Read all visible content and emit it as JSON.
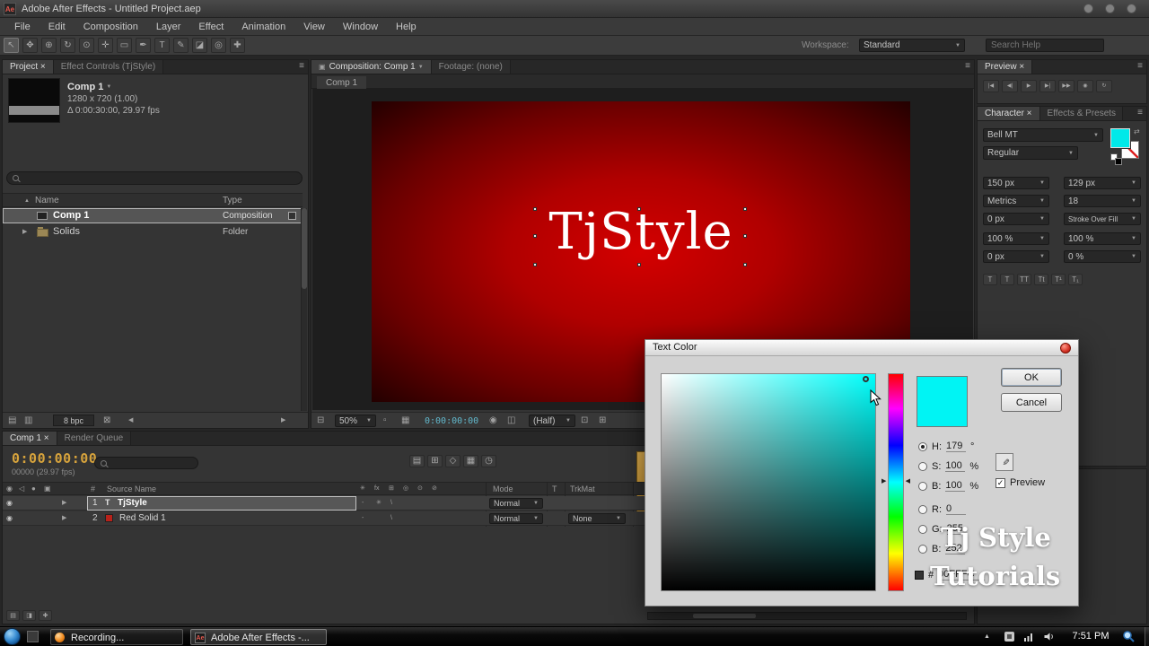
{
  "titlebar": {
    "app_icon": "Ae",
    "title": "Adobe After Effects - Untitled Project.aep"
  },
  "menubar": {
    "items": [
      "File",
      "Edit",
      "Composition",
      "Layer",
      "Effect",
      "Animation",
      "View",
      "Window",
      "Help"
    ]
  },
  "toolbar": {
    "workspace_label": "Workspace:",
    "workspace_value": "Standard",
    "search_placeholder": "Search Help"
  },
  "icons": {
    "caret": "▼",
    "twirl": "▶",
    "sort": "▲",
    "menu": "≡",
    "arrow_left": "◀",
    "arrow_right": "▶",
    "tools": [
      "↖",
      "✥",
      "⊕",
      "↻",
      "⊙",
      "✛",
      "▭",
      "✒",
      "T",
      "✎",
      "◪",
      "◎",
      "✚"
    ],
    "transport": [
      "|◀",
      "◀|",
      "▶",
      "▶|",
      "▶▶",
      "◉",
      "↻"
    ],
    "tl_left": [
      "◉",
      "◁",
      "●",
      "▣"
    ],
    "tl_mid": [
      "✳",
      "fx",
      "⊞",
      "◎",
      "⊙",
      "⊘"
    ],
    "tl_tools": [
      "▤",
      "⊞",
      "◇",
      "▦",
      "◷"
    ],
    "tl_bottom": [
      "▤",
      "◨",
      "✚"
    ],
    "viewer": [
      "⊟",
      "▫",
      "▦",
      "◉",
      "◫",
      "⊡",
      "⊞"
    ],
    "proj_footer": [
      "▤",
      "▥",
      "⊠"
    ],
    "sw": [
      "-",
      "✳",
      "\\"
    ],
    "eye": "◉",
    "text_layer": "T",
    "faux": [
      "T",
      "T",
      "TT",
      "Tt",
      "T¹",
      "T₁"
    ],
    "swap": "⇄",
    "eyedropper": "✎",
    "check": "✓",
    "comp_tab": "▣"
  },
  "project": {
    "tab_active": "Project ×",
    "tab_inactive": "Effect Controls (TjStyle)",
    "comp_name": "Comp 1",
    "comp_dims": "1280 x 720 (1.00)",
    "comp_duration": "Δ 0:00:30:00, 29.97 fps",
    "col_name": "Name",
    "col_type": "Type",
    "rows": [
      {
        "name": "Comp 1",
        "type": "Composition"
      },
      {
        "name": "Solids",
        "type": "Folder"
      }
    ],
    "bpc": "8 bpc"
  },
  "viewer": {
    "tab_comp": "Composition: Comp 1",
    "tab_footage": "Footage: (none)",
    "sub_tab": "Comp 1",
    "canvas_text": "TjStyle",
    "zoom": "50%",
    "timecode": "0:00:00:00",
    "resolution": "(Half)",
    "comp_center_color": "#c80000",
    "comp_edge_color": "#1e0000"
  },
  "preview": {
    "tab": "Preview ×"
  },
  "character": {
    "tab_character": "Character ×",
    "tab_effects": "Effects & Presets",
    "font_value": "Bell MT",
    "style_value": "Regular",
    "size_value": "150 px",
    "leading_value": "129 px",
    "kerning_value": "Metrics",
    "tracking_value": "18",
    "stroke_width": "0 px",
    "stroke_mode": "Stroke Over Fill",
    "vscale": "100 %",
    "hscale": "100 %",
    "baseline": "0 px",
    "tsume": "0 %",
    "fill_color": "#00e9e9"
  },
  "timeline": {
    "tab_comp": "Comp 1 ×",
    "tab_rq": "Render Queue",
    "timecode": "0:00:00:00",
    "frame_info": "00000 (29.97 fps)",
    "col_num": "#",
    "col_source": "Source Name",
    "col_mode": "Mode",
    "col_t": "T",
    "col_trkmat": "TrkMat",
    "layers": [
      {
        "num": "1",
        "name": "TjStyle",
        "mode": "Normal"
      },
      {
        "num": "2",
        "name": "Red Solid 1",
        "mode": "Normal",
        "trkmat": "None",
        "chip_color": "#b8221a"
      }
    ]
  },
  "dialog": {
    "title": "Text Color",
    "ok": "OK",
    "cancel": "Cancel",
    "h_label": "H:",
    "h_value": "179",
    "h_unit": "°",
    "s_label": "S:",
    "s_value": "100",
    "s_unit": "%",
    "b_label": "B:",
    "b_value": "100",
    "b_unit": "%",
    "r_label": "R:",
    "r_value": "0",
    "g_label": "G:",
    "g_value": "255",
    "b2_label": "B:",
    "b2_value": "252",
    "preview_label": "Preview",
    "hex_label": "#",
    "hex_value": "00FFFC",
    "swatch_color": "#00f4f4",
    "hue_color": "#00fffc"
  },
  "watermark": {
    "line1": "Tj Style",
    "line2": "Tutorials"
  },
  "taskbar": {
    "task1": "Recording...",
    "task2": "Adobe After Effects -...",
    "task2_icon": "Ae",
    "clock": "7:51 PM"
  }
}
